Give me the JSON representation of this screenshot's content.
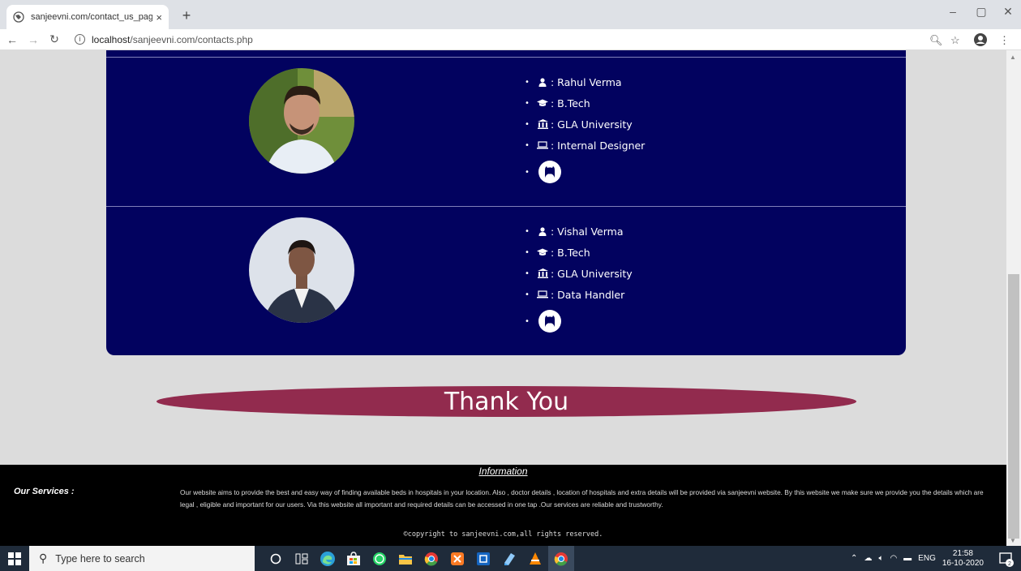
{
  "browser": {
    "tab_title": "sanjeevni.com/contact_us_page",
    "tab_close": "×",
    "new_tab": "+",
    "url_host": "localhost",
    "url_path": "/sanjeevni.com/contacts.php"
  },
  "members": [
    {
      "name": ": Rahul Verma",
      "qualification": ": B.Tech",
      "university": ": GLA University",
      "role": ": Internal Designer"
    },
    {
      "name": " : Vishal Verma",
      "qualification": " : B.Tech",
      "university": " : GLA University",
      "role": ": Data Handler"
    }
  ],
  "thanks_text": "Thank You",
  "footer": {
    "information_title": "Information",
    "services_label": "Our Services :",
    "services_text": "Our website aims to provide the best and easy way of finding available beds in hospitals in your location. Also , doctor details , location of hospitals and extra details will be provided via sanjeevni website. By this website we make sure we provide you the details which are legal , eligible and important for our users. Via this website all important and required details can be accessed in one tap .Our services are reliable and trustworthy.",
    "copyright": "©copyright to sanjeevni.com,all rights reserved."
  },
  "taskbar": {
    "search_placeholder": "Type here to search",
    "language": "ENG",
    "time": "21:58",
    "date": "16-10-2020",
    "notification_count": "2"
  },
  "colors": {
    "panel_bg": "#02025f",
    "thanks_bg": "#922b4e",
    "page_bg": "#dcdcdc",
    "footer_bg": "#000000"
  },
  "icons": [
    "user-icon",
    "graduation-cap-icon",
    "university-icon",
    "laptop-icon",
    "github-icon"
  ]
}
